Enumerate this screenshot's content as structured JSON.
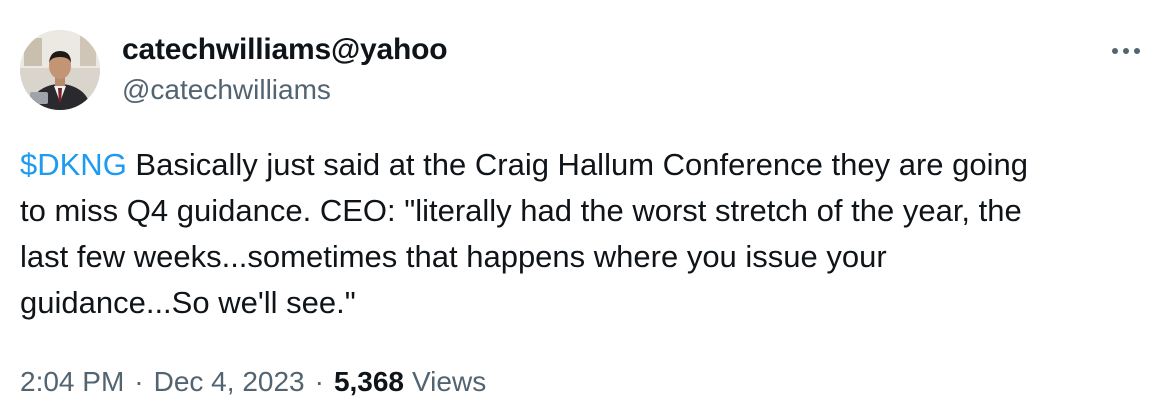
{
  "author": {
    "display_name": "catechwilliams@yahoo",
    "handle": "@catechwilliams"
  },
  "tweet": {
    "cashtag": "$DKNG",
    "text": " Basically just said at the Craig Hallum Conference they are going\nto miss Q4 guidance. CEO: \"literally had the worst stretch of the year, the\nlast few weeks...sometimes that happens where you issue your\nguidance...So we'll see.\""
  },
  "meta": {
    "time": "2:04 PM",
    "separator": "·",
    "date": "Dec 4, 2023",
    "views_count": "5,368",
    "views_label": "Views"
  },
  "colors": {
    "link": "#1d9bf0",
    "secondary_text": "#536471",
    "primary_text": "#0f1419"
  },
  "icons": {
    "more": "more-horizontal-icon"
  }
}
